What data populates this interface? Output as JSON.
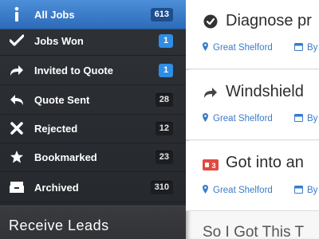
{
  "sidebar": {
    "items": [
      {
        "label": "All Jobs",
        "count": "613",
        "icon": "info-icon"
      },
      {
        "label": "Jobs Won",
        "count": "1",
        "icon": "checkmark-icon"
      },
      {
        "label": "Invited to Quote",
        "count": "1",
        "icon": "forward-arrow-icon"
      },
      {
        "label": "Quote Sent",
        "count": "28",
        "icon": "reply-arrow-icon"
      },
      {
        "label": "Rejected",
        "count": "12",
        "icon": "x-icon"
      },
      {
        "label": "Bookmarked",
        "count": "23",
        "icon": "star-icon"
      },
      {
        "label": "Archived",
        "count": "310",
        "icon": "archive-box-icon"
      }
    ],
    "receive_leads": "Receive Leads"
  },
  "jobs": [
    {
      "title": "Diagnose pr",
      "location": "Great Shelford",
      "by": "By",
      "icon": "check-circle-icon"
    },
    {
      "title": "Windshield",
      "location": "Great Shelford",
      "by": "By",
      "icon": "forward-arrow-icon"
    },
    {
      "title": "Got into an",
      "location": "Great Shelford",
      "by": "By",
      "icon": "message-badge-icon",
      "badge": "3"
    }
  ],
  "partial_title": "So I Got This T",
  "colors": {
    "accent": "#2f8de4",
    "link": "#3a7bc8",
    "active_nav": "#3d7fcc",
    "alert": "#e04a3f"
  }
}
